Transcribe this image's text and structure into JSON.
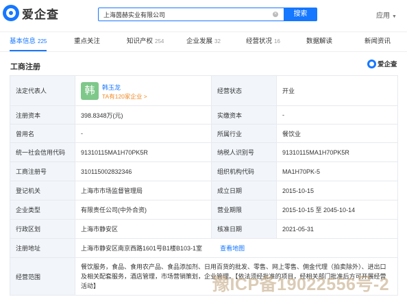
{
  "header": {
    "logo_text": "爱企查",
    "search_value": "上海茵赫实业有限公司",
    "search_button": "搜索",
    "apps_label": "应用"
  },
  "tabs": [
    {
      "label": "基本信息",
      "count": "225"
    },
    {
      "label": "重点关注",
      "count": ""
    },
    {
      "label": "知识产权",
      "count": "254"
    },
    {
      "label": "企业发展",
      "count": "32"
    },
    {
      "label": "经营状况",
      "count": "16"
    },
    {
      "label": "数据解读",
      "count": ""
    },
    {
      "label": "新闻资讯",
      "count": ""
    }
  ],
  "section": {
    "title": "工商注册",
    "brand": "爱企查"
  },
  "registration": {
    "legal_rep_label": "法定代表人",
    "legal_rep_avatar": "韩",
    "legal_rep_name": "韩玉龙",
    "legal_rep_sub": "TA有120家企业 >",
    "status_label": "经营状态",
    "status_value": "开业",
    "reg_capital_label": "注册资本",
    "reg_capital_value": "398.8348万(元)",
    "paid_capital_label": "实缴资本",
    "paid_capital_value": "-",
    "former_name_label": "曾用名",
    "former_name_value": "-",
    "industry_label": "所属行业",
    "industry_value": "餐饮业",
    "credit_code_label": "统一社会信用代码",
    "credit_code_value": "91310115MA1H70PK5R",
    "taxpayer_label": "纳税人识别号",
    "taxpayer_value": "91310115MA1H70PK5R",
    "reg_no_label": "工商注册号",
    "reg_no_value": "310115002832346",
    "org_code_label": "组织机构代码",
    "org_code_value": "MA1H70PK-5",
    "authority_label": "登记机关",
    "authority_value": "上海市市场监督管理局",
    "established_label": "成立日期",
    "established_value": "2015-10-15",
    "type_label": "企业类型",
    "type_value": "有限责任公司(中外合资)",
    "term_label": "营业期限",
    "term_value": "2015-10-15 至 2045-10-14",
    "district_label": "行政区划",
    "district_value": "上海市静安区",
    "approval_label": "核准日期",
    "approval_value": "2021-05-31",
    "address_label": "注册地址",
    "address_value": "上海市静安区南京西路1601号B1楼B103-1室",
    "map_link": "查看地图",
    "scope_label": "经营范围",
    "scope_value": "餐饮服务，食品、食用农产品、食品添加剂、日用百货的批发、零售、网上零售、佣金代理（拍卖除外）、进出口及相关配套服务，酒店管理，市场营销策划，企业管理。【依法须经批准的项目，经相关部门批准后方可开展经营活动】"
  },
  "watermark": "豫ICP备19022556号-2"
}
